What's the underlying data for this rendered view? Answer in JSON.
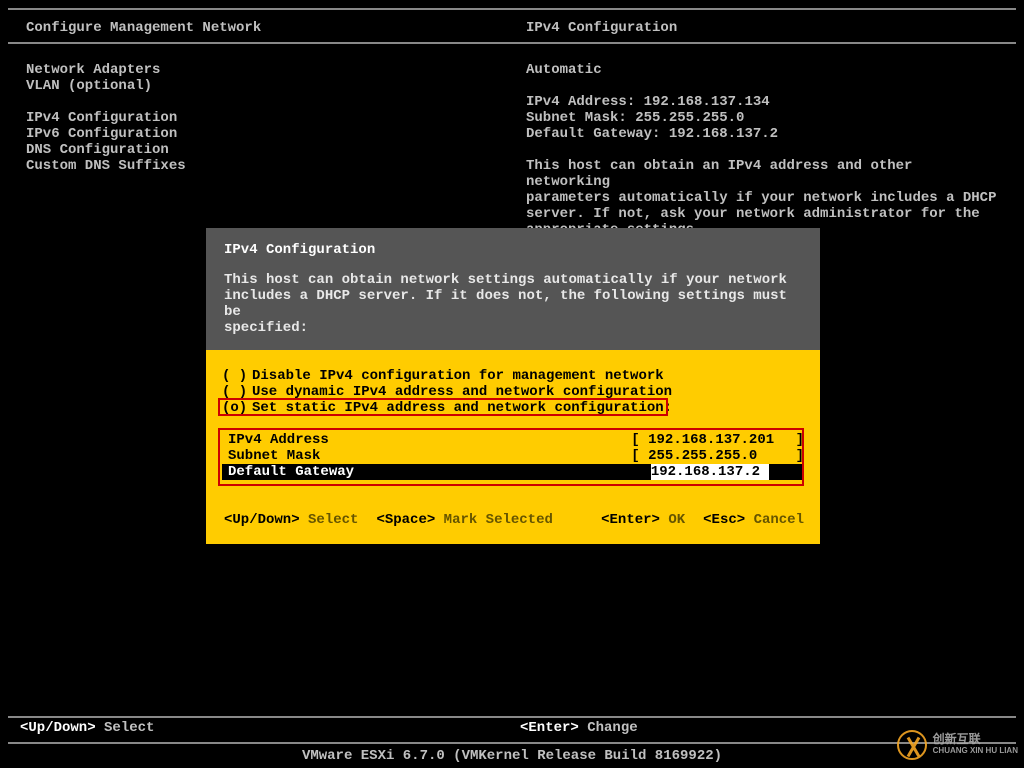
{
  "header": {
    "left": "Configure Management Network",
    "right": "IPv4 Configuration"
  },
  "left_menu": {
    "items": [
      "Network Adapters",
      "VLAN (optional)",
      "",
      "IPv4 Configuration",
      "IPv6 Configuration",
      "DNS Configuration",
      "Custom DNS Suffixes"
    ]
  },
  "right_panel": {
    "mode": "Automatic",
    "ipv4_label": "IPv4 Address:",
    "ipv4_value": "192.168.137.134",
    "subnet_label": "Subnet Mask:",
    "subnet_value": "255.255.255.0",
    "gateway_label": "Default Gateway:",
    "gateway_value": "192.168.137.2",
    "help1": "This host can obtain an IPv4 address and other networking",
    "help2": "parameters automatically if your network includes a DHCP",
    "help3": "server. If not, ask your network administrator for the",
    "help4": "appropriate settings."
  },
  "dialog": {
    "title": "IPv4 Configuration",
    "desc1": "This host can obtain network settings automatically if your network",
    "desc2": "includes a DHCP server. If it does not, the following settings must be",
    "desc3": "specified:",
    "options": [
      {
        "mark": "( )",
        "text": "Disable IPv4 configuration for management network"
      },
      {
        "mark": "( )",
        "text": "Use dynamic IPv4 address and network configuration"
      },
      {
        "mark": "(o)",
        "text": "Set static IPv4 address and network configuration:"
      }
    ],
    "fields": {
      "ipv4_label": "IPv4 Address",
      "ipv4_value": "192.168.137.201",
      "subnet_label": "Subnet Mask",
      "subnet_value": "255.255.255.0",
      "gateway_label": "Default Gateway",
      "gateway_value": "192.168.137.2"
    },
    "hints": {
      "updown_key": "<Up/Down>",
      "updown_act": "Select",
      "space_key": "<Space>",
      "space_act": "Mark Selected",
      "enter_key": "<Enter>",
      "enter_act": "OK",
      "esc_key": "<Esc>",
      "esc_act": "Cancel"
    }
  },
  "bottom": {
    "updown_key": "<Up/Down>",
    "updown_act": "Select",
    "enter_key": "<Enter>",
    "enter_act": "Change"
  },
  "footer": "VMware ESXi 6.7.0 (VMKernel Release Build 8169922)",
  "watermark": {
    "line1": "创新互联",
    "line2": "CHUANG XIN HU LIAN"
  }
}
